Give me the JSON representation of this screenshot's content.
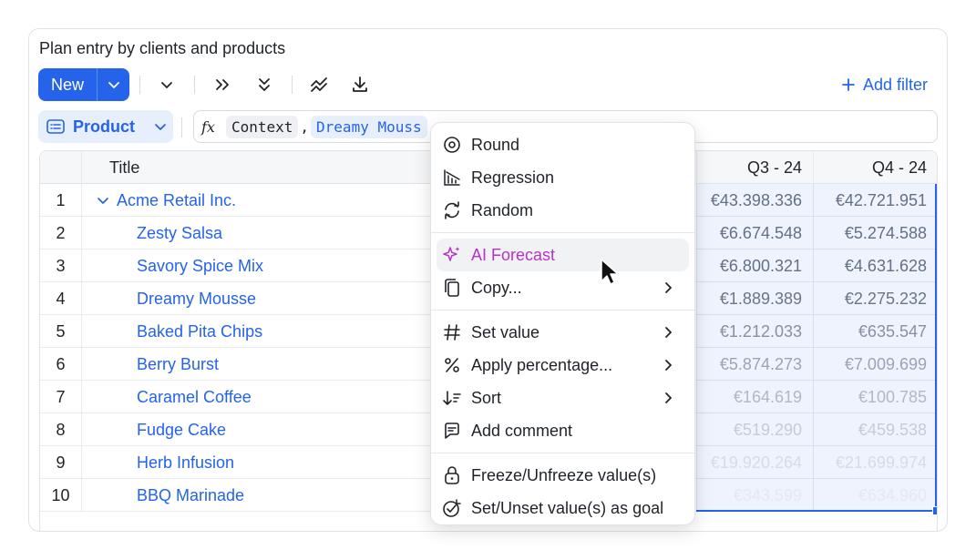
{
  "card": {
    "title": "Plan entry by clients and products"
  },
  "toolbar": {
    "new_label": "New",
    "add_filter_label": "Add filter"
  },
  "formula": {
    "dimension_label": "Product",
    "fx_label": "fx",
    "tokens": [
      "Context",
      "Dreamy Mouss"
    ],
    "separator": ","
  },
  "grid": {
    "headers": {
      "title": "Title",
      "q3": "Q3 - 24",
      "q4": "Q4 - 24"
    },
    "rows": [
      {
        "n": "1",
        "title": "Acme Retail Inc.",
        "q3": "€43.398.336",
        "q4": "€42.721.951"
      },
      {
        "n": "2",
        "title": "Zesty Salsa",
        "q3": "€6.674.548",
        "q4": "€5.274.588"
      },
      {
        "n": "3",
        "title": "Savory Spice Mix",
        "q3": "€6.800.321",
        "q4": "€4.631.628"
      },
      {
        "n": "4",
        "title": "Dreamy Mousse",
        "q3": "€1.889.389",
        "q4": "€2.275.232"
      },
      {
        "n": "5",
        "title": "Baked Pita Chips",
        "q3": "€1.212.033",
        "q4": "€635.547"
      },
      {
        "n": "6",
        "title": "Berry Burst",
        "q3": "€5.874.273",
        "q4": "€7.009.699"
      },
      {
        "n": "7",
        "title": "Caramel Coffee",
        "q3": "€164.619",
        "q4": "€100.785"
      },
      {
        "n": "8",
        "title": "Fudge Cake",
        "q3": "€519.290",
        "q4": "€459.538"
      },
      {
        "n": "9",
        "title": "Herb Infusion",
        "q3": "€19.920.264",
        "q4": "€21.699.974"
      },
      {
        "n": "10",
        "title": "BBQ Marinade",
        "q3": "€343.599",
        "q4": "€634.960"
      }
    ]
  },
  "menu": {
    "items": {
      "round": "Round",
      "regression": "Regression",
      "random": "Random",
      "ai_forecast": "AI Forecast",
      "copy": "Copy...",
      "set_value": "Set value",
      "apply_percentage": "Apply percentage...",
      "sort": "Sort",
      "add_comment": "Add comment",
      "freeze": "Freeze/Unfreeze value(s)",
      "goal": "Set/Unset value(s) as goal"
    }
  },
  "colors": {
    "accent": "#2563eb",
    "ai": "#b832c8",
    "selection_fill": "#e8effc"
  }
}
